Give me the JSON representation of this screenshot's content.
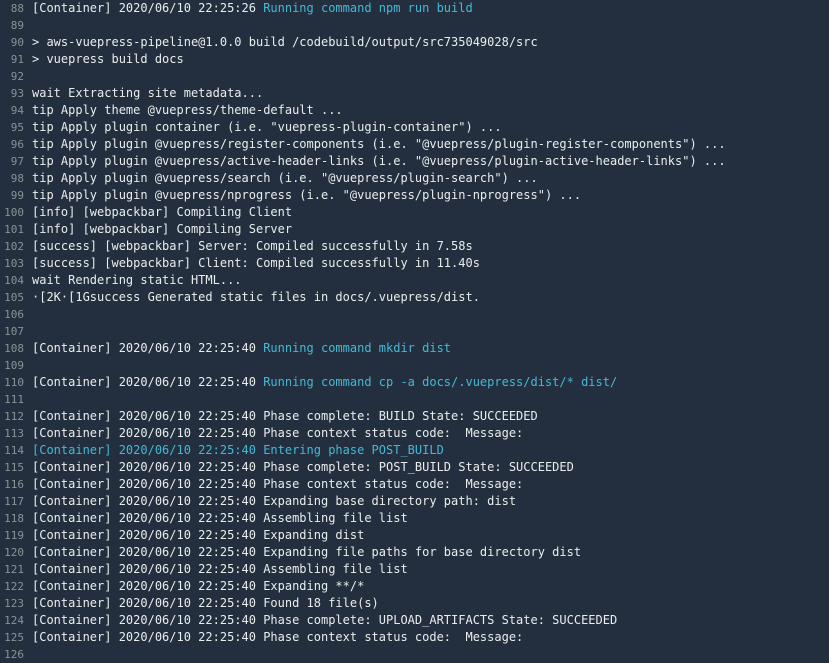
{
  "colors": {
    "background": "#232f3e",
    "text": "#eaeded",
    "line_number": "#879596",
    "highlight": "#44b9d6"
  },
  "log": {
    "lines": [
      {
        "n": "88",
        "prefix": "[Container] 2020/06/10 22:25:26 ",
        "highlight": "Running command npm run build",
        "full_highlight": false
      },
      {
        "n": "89",
        "prefix": "",
        "highlight": "",
        "full_highlight": false
      },
      {
        "n": "90",
        "prefix": "> aws-vuepress-pipeline@1.0.0 build /codebuild/output/src735049028/src",
        "highlight": "",
        "full_highlight": false
      },
      {
        "n": "91",
        "prefix": "> vuepress build docs",
        "highlight": "",
        "full_highlight": false
      },
      {
        "n": "92",
        "prefix": "",
        "highlight": "",
        "full_highlight": false
      },
      {
        "n": "93",
        "prefix": "wait Extracting site metadata...",
        "highlight": "",
        "full_highlight": false
      },
      {
        "n": "94",
        "prefix": "tip Apply theme @vuepress/theme-default ...",
        "highlight": "",
        "full_highlight": false
      },
      {
        "n": "95",
        "prefix": "tip Apply plugin container (i.e. \"vuepress-plugin-container\") ...",
        "highlight": "",
        "full_highlight": false
      },
      {
        "n": "96",
        "prefix": "tip Apply plugin @vuepress/register-components (i.e. \"@vuepress/plugin-register-components\") ...",
        "highlight": "",
        "full_highlight": false
      },
      {
        "n": "97",
        "prefix": "tip Apply plugin @vuepress/active-header-links (i.e. \"@vuepress/plugin-active-header-links\") ...",
        "highlight": "",
        "full_highlight": false
      },
      {
        "n": "98",
        "prefix": "tip Apply plugin @vuepress/search (i.e. \"@vuepress/plugin-search\") ...",
        "highlight": "",
        "full_highlight": false
      },
      {
        "n": "99",
        "prefix": "tip Apply plugin @vuepress/nprogress (i.e. \"@vuepress/plugin-nprogress\") ...",
        "highlight": "",
        "full_highlight": false
      },
      {
        "n": "100",
        "prefix": "[info] [webpackbar] Compiling Client",
        "highlight": "",
        "full_highlight": false
      },
      {
        "n": "101",
        "prefix": "[info] [webpackbar] Compiling Server",
        "highlight": "",
        "full_highlight": false
      },
      {
        "n": "102",
        "prefix": "[success] [webpackbar] Server: Compiled successfully in 7.58s",
        "highlight": "",
        "full_highlight": false
      },
      {
        "n": "103",
        "prefix": "[success] [webpackbar] Client: Compiled successfully in 11.40s",
        "highlight": "",
        "full_highlight": false
      },
      {
        "n": "104",
        "prefix": "wait Rendering static HTML...",
        "highlight": "",
        "full_highlight": false
      },
      {
        "n": "105",
        "prefix": "·[2K·[1Gsuccess Generated static files in docs/.vuepress/dist.",
        "highlight": "",
        "full_highlight": false
      },
      {
        "n": "106",
        "prefix": "",
        "highlight": "",
        "full_highlight": false
      },
      {
        "n": "107",
        "prefix": "",
        "highlight": "",
        "full_highlight": false
      },
      {
        "n": "108",
        "prefix": "[Container] 2020/06/10 22:25:40 ",
        "highlight": "Running command mkdir dist",
        "full_highlight": false
      },
      {
        "n": "109",
        "prefix": "",
        "highlight": "",
        "full_highlight": false
      },
      {
        "n": "110",
        "prefix": "[Container] 2020/06/10 22:25:40 ",
        "highlight": "Running command cp -a docs/.vuepress/dist/* dist/",
        "full_highlight": false
      },
      {
        "n": "111",
        "prefix": "",
        "highlight": "",
        "full_highlight": false
      },
      {
        "n": "112",
        "prefix": "[Container] 2020/06/10 22:25:40 Phase complete: BUILD State: SUCCEEDED",
        "highlight": "",
        "full_highlight": false
      },
      {
        "n": "113",
        "prefix": "[Container] 2020/06/10 22:25:40 Phase context status code:  Message:",
        "highlight": "",
        "full_highlight": false
      },
      {
        "n": "114",
        "prefix": "",
        "highlight": "[Container] 2020/06/10 22:25:40 Entering phase POST_BUILD",
        "full_highlight": true
      },
      {
        "n": "115",
        "prefix": "[Container] 2020/06/10 22:25:40 Phase complete: POST_BUILD State: SUCCEEDED",
        "highlight": "",
        "full_highlight": false
      },
      {
        "n": "116",
        "prefix": "[Container] 2020/06/10 22:25:40 Phase context status code:  Message:",
        "highlight": "",
        "full_highlight": false
      },
      {
        "n": "117",
        "prefix": "[Container] 2020/06/10 22:25:40 Expanding base directory path: dist",
        "highlight": "",
        "full_highlight": false
      },
      {
        "n": "118",
        "prefix": "[Container] 2020/06/10 22:25:40 Assembling file list",
        "highlight": "",
        "full_highlight": false
      },
      {
        "n": "119",
        "prefix": "[Container] 2020/06/10 22:25:40 Expanding dist",
        "highlight": "",
        "full_highlight": false
      },
      {
        "n": "120",
        "prefix": "[Container] 2020/06/10 22:25:40 Expanding file paths for base directory dist",
        "highlight": "",
        "full_highlight": false
      },
      {
        "n": "121",
        "prefix": "[Container] 2020/06/10 22:25:40 Assembling file list",
        "highlight": "",
        "full_highlight": false
      },
      {
        "n": "122",
        "prefix": "[Container] 2020/06/10 22:25:40 Expanding **/*",
        "highlight": "",
        "full_highlight": false
      },
      {
        "n": "123",
        "prefix": "[Container] 2020/06/10 22:25:40 Found 18 file(s)",
        "highlight": "",
        "full_highlight": false
      },
      {
        "n": "124",
        "prefix": "[Container] 2020/06/10 22:25:40 Phase complete: UPLOAD_ARTIFACTS State: SUCCEEDED",
        "highlight": "",
        "full_highlight": false
      },
      {
        "n": "125",
        "prefix": "[Container] 2020/06/10 22:25:40 Phase context status code:  Message:",
        "highlight": "",
        "full_highlight": false
      },
      {
        "n": "126",
        "prefix": "",
        "highlight": "",
        "full_highlight": false
      }
    ]
  }
}
